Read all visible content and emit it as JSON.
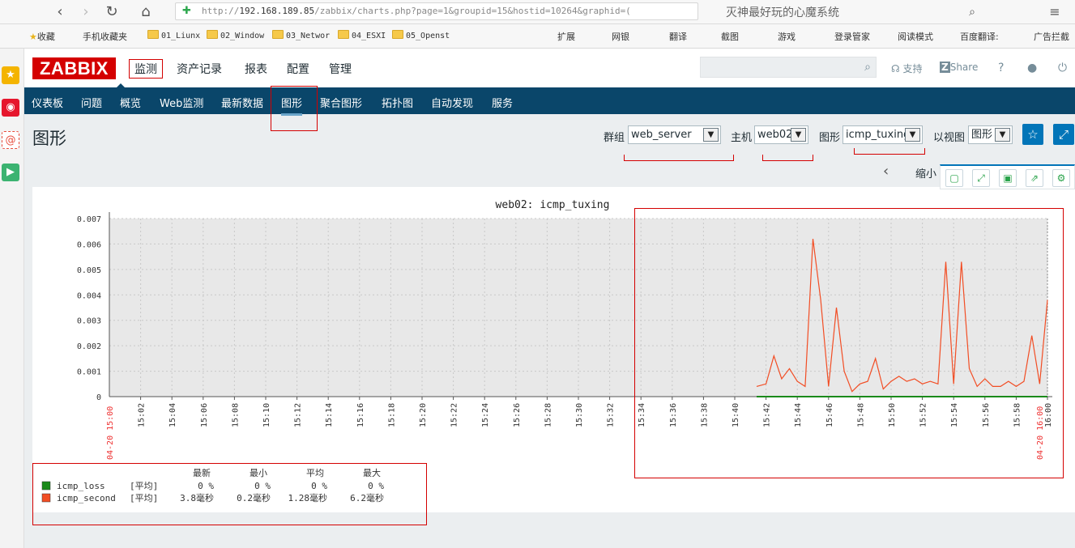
{
  "browser": {
    "url_prefix": "http://",
    "url_host": "192.168.189.85",
    "url_path": "/zabbix/charts.php?page=1&groupid=15&hostid=10264&graphid=(",
    "search_hint": "灭神最好玩的心魔系统",
    "bookmarks": [
      "收藏",
      "手机收藏夹",
      "01_Liunx",
      "02_Window",
      "03_Networ",
      "04_ESXI",
      "05_Openst",
      "扩展",
      "网银",
      "翻译",
      "截图",
      "游戏",
      "登录管家",
      "阅读模式",
      "百度翻译:",
      "广告拦截"
    ]
  },
  "header": {
    "logo": "ZABBIX",
    "menu": [
      "监测",
      "资产记录",
      "报表",
      "配置",
      "管理"
    ],
    "support": "支持",
    "share": "Share",
    "help": "?"
  },
  "submenu": [
    "仪表板",
    "问题",
    "概览",
    "Web监测",
    "最新数据",
    "图形",
    "聚合图形",
    "拓扑图",
    "自动发现",
    "服务"
  ],
  "page": {
    "title": "图形",
    "filters": {
      "group_label": "群组",
      "group_value": "web_server",
      "host_label": "主机",
      "host_value": "web02",
      "graph_label": "图形",
      "graph_value": "icmp_tuxing",
      "view_label": "以视图",
      "view_value": "图形"
    },
    "zoom_out": "缩小"
  },
  "chart_data": {
    "type": "line",
    "title": "web02: icmp_tuxing",
    "ylim": [
      0,
      0.007
    ],
    "y_ticks": [
      "0.007",
      "0.006",
      "0.005",
      "0.004",
      "0.003",
      "0.002",
      "0.001",
      "0"
    ],
    "x_ticks": [
      "15:02",
      "15:04",
      "15:06",
      "15:08",
      "15:10",
      "15:12",
      "15:14",
      "15:16",
      "15:18",
      "15:20",
      "15:22",
      "15:24",
      "15:26",
      "15:28",
      "15:30",
      "15:32",
      "15:34",
      "15:36",
      "15:38",
      "15:40",
      "15:42",
      "15:44",
      "15:46",
      "15:48",
      "15:50",
      "15:52",
      "15:54",
      "15:56",
      "15:58",
      "16:00"
    ],
    "x_start_label": "04-20 15:00",
    "x_end_label": "04-20 16:00",
    "xlim_minutes": [
      0,
      60
    ],
    "series": [
      {
        "name": "icmp_second",
        "color": "#f24d24",
        "x": [
          41.4,
          42.0,
          42.5,
          43.0,
          43.5,
          44.0,
          44.5,
          45.0,
          45.5,
          46.0,
          46.5,
          47.0,
          47.5,
          48.0,
          48.5,
          49.0,
          49.5,
          50.0,
          50.5,
          51.0,
          51.5,
          52.0,
          52.5,
          53.0,
          53.5,
          54.0,
          54.5,
          55.0,
          55.5,
          56.0,
          56.5,
          57.0,
          57.5,
          58.0,
          58.5,
          59.0,
          59.5,
          60.0
        ],
        "values": [
          0.0004,
          0.0005,
          0.0016,
          0.0007,
          0.0011,
          0.0006,
          0.0004,
          0.0062,
          0.0038,
          0.0004,
          0.0035,
          0.001,
          0.0002,
          0.0005,
          0.0006,
          0.0015,
          0.0003,
          0.0006,
          0.0008,
          0.0006,
          0.0007,
          0.0005,
          0.0006,
          0.0005,
          0.0053,
          0.0005,
          0.0053,
          0.0011,
          0.0004,
          0.0007,
          0.0004,
          0.0004,
          0.0006,
          0.0004,
          0.0006,
          0.0024,
          0.0005,
          0.0038
        ]
      },
      {
        "name": "icmp_loss",
        "color": "#1a8a1a",
        "x": [
          41.4,
          60.0
        ],
        "values": [
          0,
          0
        ]
      }
    ],
    "legend": {
      "headers": [
        "最新",
        "最小",
        "平均",
        "最大"
      ],
      "rows": [
        {
          "name": "icmp_loss",
          "func": "[平均]",
          "last": "0 %",
          "min": "0 %",
          "avg": "0 %",
          "max": "0 %",
          "color": "#1a8a1a"
        },
        {
          "name": "icmp_second",
          "func": "[平均]",
          "last": "3.8毫秒",
          "min": "0.2毫秒",
          "avg": "1.28毫秒",
          "max": "6.2毫秒",
          "color": "#f24d24"
        }
      ]
    }
  }
}
